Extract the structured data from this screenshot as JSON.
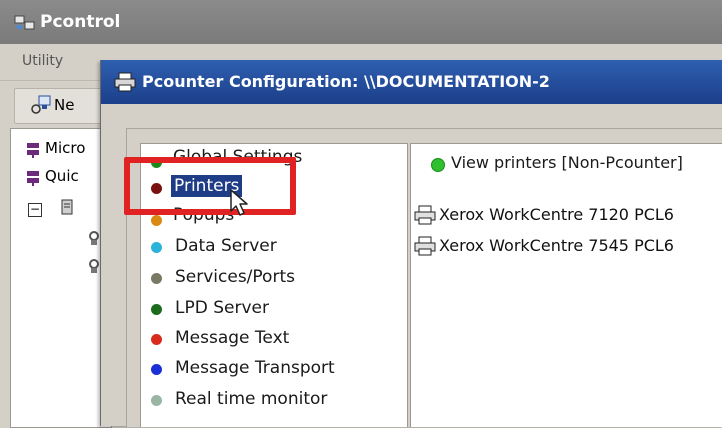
{
  "background_window": {
    "title": "Pcontrol",
    "menu": {
      "utility": "Utility"
    },
    "toolbar": {
      "new_label": "Ne"
    },
    "tree_items": [
      {
        "label": "Micro"
      },
      {
        "label": "Quic"
      }
    ],
    "tree_expander": "−"
  },
  "dialog": {
    "title": "Pcounter Configuration: \\\\DOCUMENTATION-2",
    "nav_items": [
      {
        "label": "Global Settings",
        "color": "#1a8a1a"
      },
      {
        "label": "Printers",
        "color": "#7a1111"
      },
      {
        "label": "Popups",
        "color": "#d98a12"
      },
      {
        "label": "Data Server",
        "color": "#2bb3d8"
      },
      {
        "label": "Services/Ports",
        "color": "#7a7a64"
      },
      {
        "label": "LPD Server",
        "color": "#1d6b1d"
      },
      {
        "label": "Message Text",
        "color": "#d82b1e"
      },
      {
        "label": "Message Transport",
        "color": "#1a2fd6"
      },
      {
        "label": "Real time monitor",
        "color": "#9ab5a4"
      }
    ],
    "selected_nav": "Printers",
    "view_printers_label": "View printers [Non-Pcounter]",
    "view_printers_color": "#2fbf2f",
    "printers": [
      {
        "name": "Xerox WorkCentre 7120 PCL6"
      },
      {
        "name": "Xerox WorkCentre 7545 PCL6"
      }
    ]
  },
  "annotation": {
    "highlight_color": "#e02222"
  }
}
